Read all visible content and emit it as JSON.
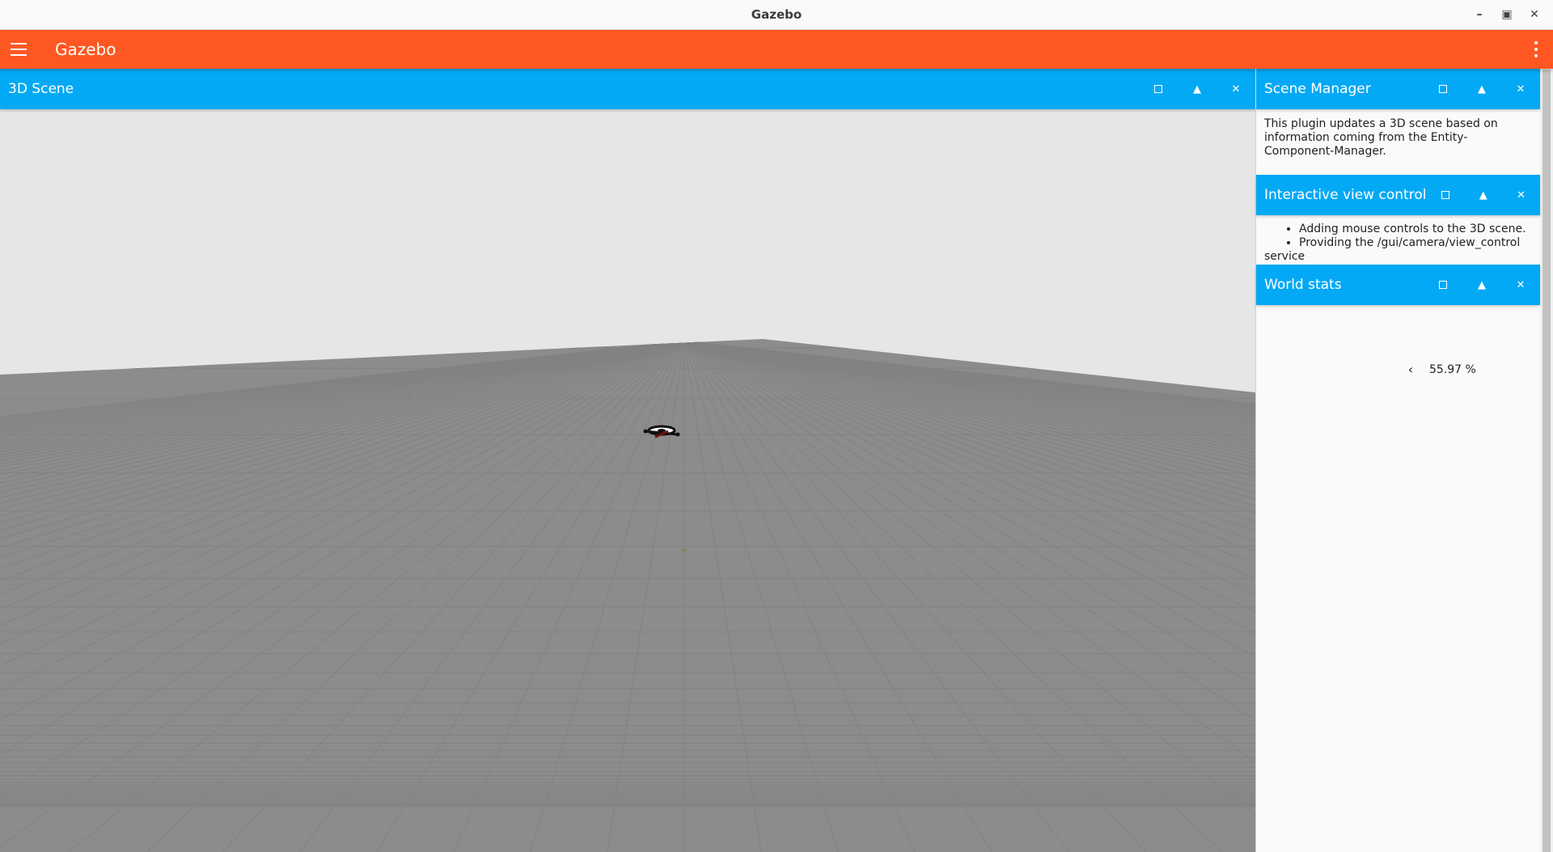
{
  "window": {
    "title": "Gazebo"
  },
  "appbar": {
    "title": "Gazebo"
  },
  "scene_panel": {
    "title": "3D Scene"
  },
  "scene_manager": {
    "title": "Scene Manager",
    "description": "This plugin updates a 3D scene based on information coming from the Entity-Component-Manager."
  },
  "view_control": {
    "title": "Interactive view control",
    "items": [
      "Adding mouse controls to the 3D scene.",
      "Providing the /gui/camera/view_control"
    ],
    "tail": "service"
  },
  "world_stats": {
    "title": "World stats",
    "rtf": "55.97 %"
  },
  "colors": {
    "appbar": "#ff5722",
    "panel_header": "#03a9f4",
    "sky": "#e6e6e6",
    "ground": "#8c8c8c"
  },
  "icons": {
    "menu": "hamburger-icon",
    "more": "kebab-icon",
    "minimize": "minimize-icon",
    "maximize": "maximize-icon",
    "close": "close-icon",
    "float": "float-square-icon",
    "collapse": "collapse-triangle-icon",
    "expand": "chevron-left-icon"
  }
}
